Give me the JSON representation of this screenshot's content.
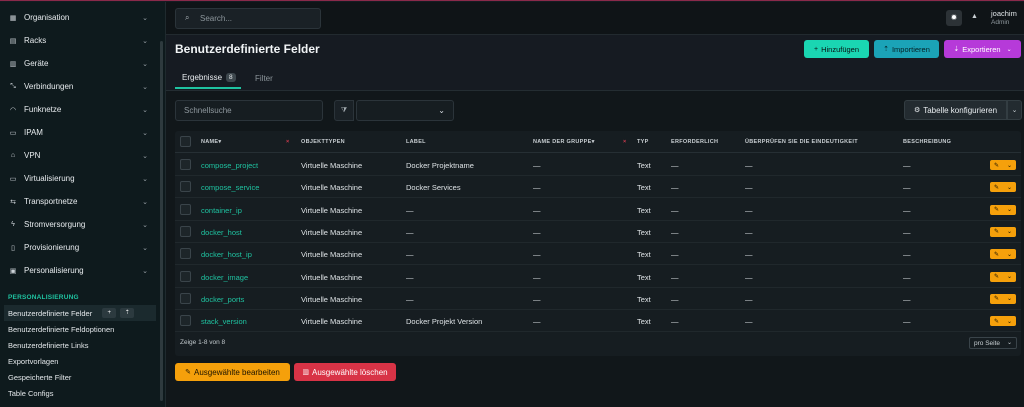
{
  "sidebar": {
    "items": [
      {
        "label": "Organisation",
        "icon": "building-icon"
      },
      {
        "label": "Racks",
        "icon": "rack-icon"
      },
      {
        "label": "Geräte",
        "icon": "server-icon"
      },
      {
        "label": "Verbindungen",
        "icon": "connection-icon"
      },
      {
        "label": "Funknetze",
        "icon": "wifi-icon"
      },
      {
        "label": "IPAM",
        "icon": "counter-icon"
      },
      {
        "label": "VPN",
        "icon": "tunnel-icon"
      },
      {
        "label": "Virtualisierung",
        "icon": "monitor-icon"
      },
      {
        "label": "Transportnetze",
        "icon": "transit-icon"
      },
      {
        "label": "Stromversorgung",
        "icon": "power-plug-icon"
      },
      {
        "label": "Provisionierung",
        "icon": "file-document-icon"
      },
      {
        "label": "Personalisierung",
        "icon": "toolbox-icon"
      }
    ],
    "section_title": "PERSONALISIERUNG",
    "sub_items": [
      "Benutzerdefinierte Felder",
      "Benutzerdefinierte Feldoptionen",
      "Benutzerdefinierte Links",
      "Exportvorlagen",
      "Gespeicherte Filter",
      "Table Configs"
    ],
    "add_label": "+",
    "import_label": "⇡"
  },
  "topbar": {
    "search_placeholder": "Search...",
    "user_name": "joachim",
    "user_role": "Admin"
  },
  "page": {
    "title": "Benutzerdefinierte Felder",
    "add_button": "Hinzufügen",
    "import_button": "Importieren",
    "export_button": "Exportieren",
    "tabs": {
      "results": "Ergebnisse",
      "results_count": "8",
      "filter": "Filter"
    },
    "quick_search_placeholder": "Schnellsuche",
    "configure_table": "Tabelle konfigurieren",
    "footer_info": "Zeige 1-8 von 8",
    "per_page": "pro Seite",
    "edit_selected": "Ausgewählte bearbeiten",
    "delete_selected": "Ausgewählte löschen"
  },
  "table": {
    "headers": {
      "name": "NAME",
      "object_types": "OBJEKTTYPEN",
      "label": "LABEL",
      "group_name": "NAME DER GRUPPE",
      "type": "TYP",
      "required": "ERFORDERLICH",
      "validate_unique": "ÜBERPRÜFEN SIE DIE EINDEUTIGKEIT",
      "description": "BESCHREIBUNG"
    },
    "rows": [
      {
        "name": "compose_project",
        "object_types": "Virtuelle Maschine",
        "label": "Docker Projektname",
        "group_name": "—",
        "type": "Text",
        "required": "—",
        "validate_unique": "—",
        "description": "—"
      },
      {
        "name": "compose_service",
        "object_types": "Virtuelle Maschine",
        "label": "Docker Services",
        "group_name": "—",
        "type": "Text",
        "required": "—",
        "validate_unique": "—",
        "description": "—"
      },
      {
        "name": "container_ip",
        "object_types": "Virtuelle Maschine",
        "label": "—",
        "group_name": "—",
        "type": "Text",
        "required": "—",
        "validate_unique": "—",
        "description": "—"
      },
      {
        "name": "docker_host",
        "object_types": "Virtuelle Maschine",
        "label": "—",
        "group_name": "—",
        "type": "Text",
        "required": "—",
        "validate_unique": "—",
        "description": "—"
      },
      {
        "name": "docker_host_ip",
        "object_types": "Virtuelle Maschine",
        "label": "—",
        "group_name": "—",
        "type": "Text",
        "required": "—",
        "validate_unique": "—",
        "description": "—"
      },
      {
        "name": "docker_image",
        "object_types": "Virtuelle Maschine",
        "label": "—",
        "group_name": "—",
        "type": "Text",
        "required": "—",
        "validate_unique": "—",
        "description": "—"
      },
      {
        "name": "docker_ports",
        "object_types": "Virtuelle Maschine",
        "label": "—",
        "group_name": "—",
        "type": "Text",
        "required": "—",
        "validate_unique": "—",
        "description": "—"
      },
      {
        "name": "stack_version",
        "object_types": "Virtuelle Maschine",
        "label": "Docker Projekt Version",
        "group_name": "—",
        "type": "Text",
        "required": "—",
        "validate_unique": "—",
        "description": "—"
      }
    ]
  },
  "colors": {
    "accent": "#1fc3a1",
    "add": "#1ad6b2",
    "import": "#1ba3b7",
    "export": "#b63ad9",
    "edit": "#f5a00b",
    "delete": "#d83346"
  }
}
